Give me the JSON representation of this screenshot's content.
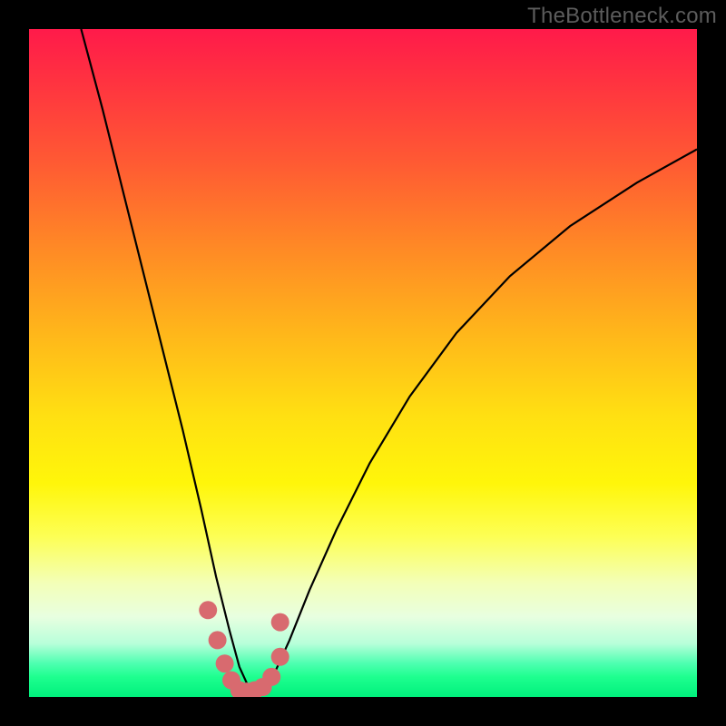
{
  "watermark": "TheBottleneck.com",
  "chart_data": {
    "type": "line",
    "title": "",
    "xlabel": "",
    "ylabel": "",
    "xlim": [
      0,
      1
    ],
    "ylim": [
      0,
      1
    ],
    "description": "Bottleneck curve over rainbow gradient background. X axis represents component balance ratio; Y axis represents bottleneck percentage (top = high bottleneck, bottom = optimal). Curve is a V shape with minimum near x≈0.33. Green zone at bottom indicates optimal pairing; red at top indicates severe bottleneck.",
    "series": [
      {
        "name": "bottleneck-curve",
        "color": "#000000",
        "x": [
          0.078,
          0.11,
          0.14,
          0.17,
          0.2,
          0.23,
          0.258,
          0.28,
          0.3,
          0.315,
          0.33,
          0.345,
          0.365,
          0.39,
          0.42,
          0.46,
          0.51,
          0.57,
          0.64,
          0.72,
          0.81,
          0.91,
          1.0
        ],
        "y": [
          1.0,
          0.88,
          0.76,
          0.64,
          0.52,
          0.4,
          0.28,
          0.18,
          0.1,
          0.045,
          0.012,
          0.01,
          0.03,
          0.085,
          0.16,
          0.25,
          0.35,
          0.45,
          0.545,
          0.63,
          0.705,
          0.77,
          0.82
        ]
      },
      {
        "name": "highlight-dots",
        "color": "#d86a6f",
        "type": "scatter",
        "x": [
          0.268,
          0.282,
          0.293,
          0.303,
          0.315,
          0.326,
          0.338,
          0.35,
          0.363,
          0.376,
          0.376
        ],
        "y": [
          0.13,
          0.085,
          0.05,
          0.025,
          0.01,
          0.008,
          0.01,
          0.015,
          0.03,
          0.06,
          0.112
        ]
      }
    ]
  }
}
